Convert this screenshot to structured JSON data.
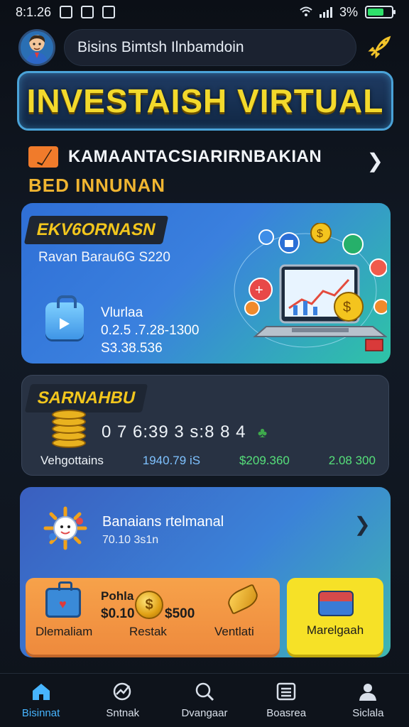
{
  "status_bar": {
    "time": "8:1.26",
    "battery_text": "3%"
  },
  "header": {
    "search_text": "Bisins Bimtsh Ilnbamdoin",
    "avatar": "user-avatar",
    "right_icon": "rocket-icon"
  },
  "banner": {
    "title": "INVESTAISH VIRTUAL"
  },
  "notice": {
    "title": "KAMAANTACSIARIRNBAKIAN",
    "subtitle": "BED INNUNAN"
  },
  "card_invest": {
    "tag": "EKV6ORNASN",
    "subline": "Ravan Barau6G S220",
    "label": "Vlurlaa",
    "value1": "0.2.5 .7.28-1300",
    "value2": "S3.38.536"
  },
  "card_summary": {
    "tag": "SARNAHBU",
    "amount": "0 7 6:39 3 s:8 8 4",
    "label": "Vehgottains",
    "stat_blue": "1940.79 iS",
    "stat_green": "$209.360",
    "stat_right": "2.08 300"
  },
  "card_promo": {
    "title": "Banaians rtelmanal",
    "subtitle": "70.10 3s1n",
    "promo_top": "Pohla",
    "promo_amount1": "$0.10",
    "promo_amount2": "$500",
    "promo_left_label": "Dlemaliam",
    "promo_mid_label": "Restak",
    "promo_right_label": "Ventlati",
    "side_label": "Marelgaah"
  },
  "bottom_nav": [
    {
      "label": "Bisinnat",
      "icon": "home-icon"
    },
    {
      "label": "Sntnak",
      "icon": "chart-icon"
    },
    {
      "label": "Dvangaar",
      "icon": "search-icon"
    },
    {
      "label": "Boasrea",
      "icon": "list-icon"
    },
    {
      "label": "Siclala",
      "icon": "profile-icon"
    }
  ],
  "colors": {
    "accent": "#47b5ff",
    "title_yellow": "#f3d92c",
    "notice_orange": "#f0b531"
  }
}
